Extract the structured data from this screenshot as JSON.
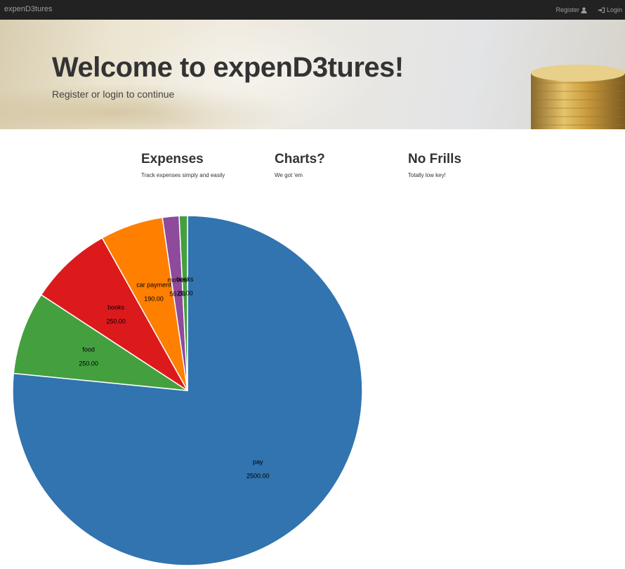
{
  "navbar": {
    "brand": "expenD3tures",
    "register_label": "Register",
    "login_label": "Login",
    "register_icon": "user-icon",
    "login_icon": "log-in-icon"
  },
  "jumbotron": {
    "title": "Welcome to expenD3tures!",
    "subtitle": "Register or login to continue"
  },
  "features": [
    {
      "title": "Expenses",
      "text": "Track expenses simply and easily"
    },
    {
      "title": "Charts?",
      "text": "We got 'em"
    },
    {
      "title": "No Frills",
      "text": "Totally low key!"
    }
  ],
  "chart_data": {
    "type": "pie",
    "slices": [
      {
        "label": "pay",
        "value": 2500.0,
        "value_label": "2500.00",
        "color": "#3174af"
      },
      {
        "label": "food",
        "value": 250.0,
        "value_label": "250.00",
        "color": "#44a03f"
      },
      {
        "label": "books",
        "value": 250.0,
        "value_label": "250.00",
        "color": "#dc1a1c"
      },
      {
        "label": "car payment",
        "value": 190.0,
        "value_label": "190.00",
        "color": "#ff7f00"
      },
      {
        "label": "movies",
        "value": 50.0,
        "value_label": "50.00",
        "color": "#8e4a9b"
      },
      {
        "label": "books",
        "value": 25.0,
        "value_label": "25.00",
        "color": "#44a03f"
      }
    ]
  }
}
